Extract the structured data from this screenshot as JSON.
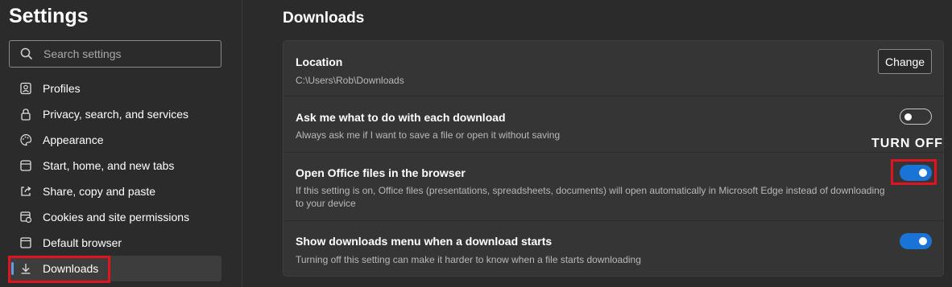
{
  "sidebar": {
    "title": "Settings",
    "search_placeholder": "Search settings",
    "items": [
      {
        "label": "Profiles",
        "icon": "profile-icon"
      },
      {
        "label": "Privacy, search, and services",
        "icon": "lock-icon"
      },
      {
        "label": "Appearance",
        "icon": "palette-icon"
      },
      {
        "label": "Start, home, and new tabs",
        "icon": "power-icon"
      },
      {
        "label": "Share, copy and paste",
        "icon": "share-icon"
      },
      {
        "label": "Cookies and site permissions",
        "icon": "site-permissions-icon"
      },
      {
        "label": "Default browser",
        "icon": "browser-icon"
      },
      {
        "label": "Downloads",
        "icon": "download-icon",
        "active": true
      }
    ]
  },
  "main": {
    "title": "Downloads",
    "location": {
      "title": "Location",
      "path": "C:\\Users\\Rob\\Downloads",
      "button_label": "Change"
    },
    "settings": [
      {
        "title": "Ask me what to do with each download",
        "description": "Always ask me if I want to save a file or open it without saving",
        "enabled": false
      },
      {
        "title": "Open Office files in the browser",
        "description": "If this setting is on, Office files (presentations, spreadsheets, documents) will open automatically in Microsoft Edge instead of downloading to your device",
        "enabled": true
      },
      {
        "title": "Show downloads menu when a download starts",
        "description": "Turning off this setting can make it harder to know when a file starts downloading",
        "enabled": true
      }
    ]
  },
  "annotation": {
    "text": "TURN OFF",
    "color": "#e0141e"
  },
  "colors": {
    "background": "#2b2b2b",
    "card": "#353535",
    "accent": "#1a73d6"
  }
}
